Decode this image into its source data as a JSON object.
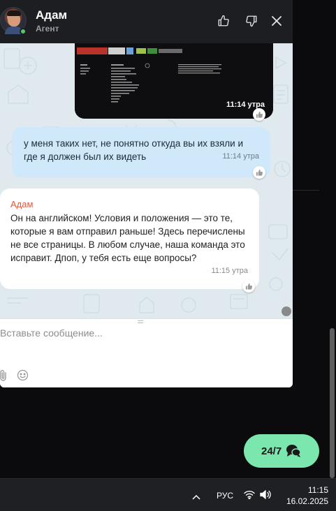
{
  "chat_header": {
    "agent_name": "Адам",
    "agent_role": "Агент"
  },
  "messages": [
    {
      "type": "image",
      "time": "11:14 утра"
    },
    {
      "type": "outgoing",
      "text": "у меня таких нет, не понятно откуда вы их взяли и где я должен был их видеть",
      "time": "11:14 утра"
    },
    {
      "type": "incoming",
      "author": "Адам",
      "text": "Он на английском! Условия и положения — это те, которые я вам отправил раньше! Здесь перечислены не все страницы. В любом случае, наша команда это исправит. Дпоп, у тебя есть еще вопросы?",
      "time": "11:15 утра"
    }
  ],
  "composer": {
    "placeholder": "Вставьте сообщение..."
  },
  "support_button": {
    "label": "24/7"
  },
  "taskbar": {
    "language": "РУС",
    "time": "11:15",
    "date": "16.02.2025"
  },
  "colors": {
    "header_bg": "#1d1e22",
    "chat_bg": "#dfe9ee",
    "outgoing_bubble": "#cfe9fb",
    "incoming_author": "#e0563a",
    "support_button": "#7be6ad",
    "online_status": "#59c46d"
  }
}
